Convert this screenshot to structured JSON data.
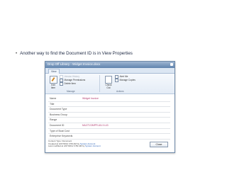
{
  "slide": {
    "bullet_text": "Another way to find the Document ID is in View Properties"
  },
  "dialog": {
    "title": "Drop Off Library - Widget Invoice.docx",
    "tabs": [
      {
        "label": "View"
      }
    ],
    "ribbon": {
      "edit_item": {
        "label": "Edit Item"
      },
      "manage_items": [
        {
          "label": "Version History",
          "disabled": true
        },
        {
          "label": "Manage Permissions",
          "disabled": false
        },
        {
          "label": "Delete Item",
          "disabled": false
        }
      ],
      "action_items": [
        {
          "label": "Alert Me",
          "disabled": false
        },
        {
          "label": "Manage Copies",
          "disabled": false
        }
      ],
      "checkout_item": {
        "label": "Check Out"
      },
      "groups": {
        "manage": "Manage",
        "actions": "Actions"
      }
    },
    "properties": [
      {
        "name": "Name",
        "value": "Widget Invoice"
      },
      {
        "name": "Title",
        "value": ""
      },
      {
        "name": "Document Type",
        "value": ""
      },
      {
        "name": "Business Group",
        "value": ""
      },
      {
        "name": "Range",
        "value": ""
      },
      {
        "name": "Document ID",
        "value": "MUZ7V2MPFUUV-9-43"
      },
      {
        "name": "Type of Boat Cost",
        "value": ""
      },
      {
        "name": "Enterprise Keywords",
        "value": ""
      }
    ],
    "footer": {
      "content_type": "Content Type: Document",
      "created_prefix": "Created at 4/27/2012 3:59 AM by",
      "created_by": "System Account",
      "modified_prefix": "Last modified at 4/27/2012 3:59 AM by",
      "modified_by": "System Account",
      "close_label": "Close"
    }
  },
  "colors": {
    "titlebar": "#5f83ad",
    "value_text": "#b23b6f",
    "link": "#2a62b8"
  },
  "icons": {
    "edit": "edit-item-icon",
    "checkout": "check-out-icon"
  }
}
